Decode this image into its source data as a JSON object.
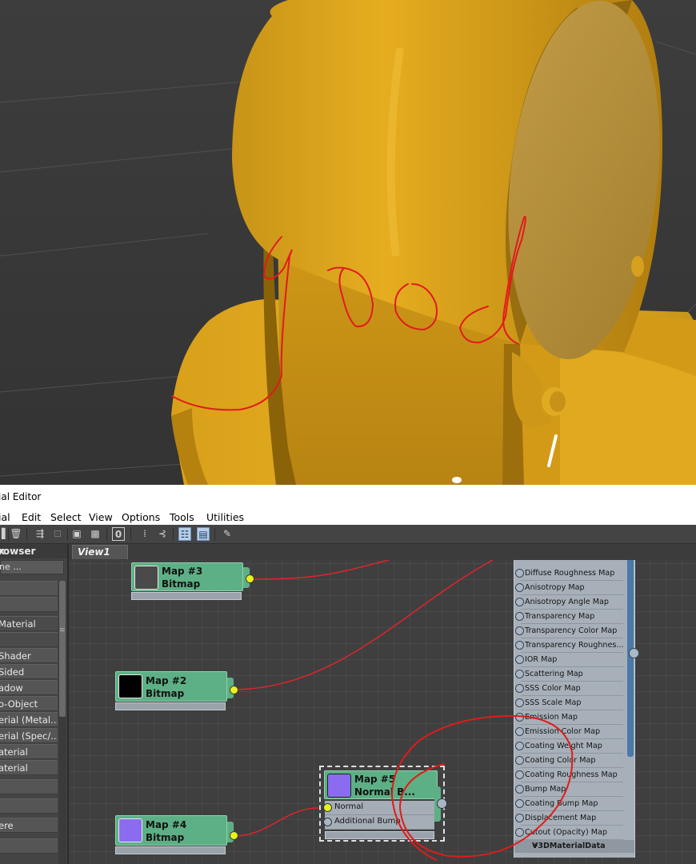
{
  "window": {
    "title": "ial Editor"
  },
  "menu": {
    "items": [
      "ial",
      "Edit",
      "Select",
      "View",
      "Options",
      "Tools",
      "Utilities"
    ]
  },
  "toolbar": {
    "zero_label": "0"
  },
  "browser": {
    "title": "rowser",
    "close_label": "x",
    "search_placeholder": "ne ...",
    "items": [
      "",
      "",
      "Material",
      "",
      "Shader",
      "Sided",
      "adow",
      "o-Object",
      "erial (Metal...",
      "erial (Spec/...",
      "aterial",
      "aterial",
      "",
      "",
      "ere",
      ""
    ]
  },
  "view_tab": {
    "label": "View1"
  },
  "nodes": {
    "map3": {
      "name": "Map #3",
      "type": "Bitmap",
      "swatch_color": "#4a4a4a"
    },
    "map2": {
      "name": "Map #2",
      "type": "Bitmap",
      "swatch_color": "#000000"
    },
    "map4": {
      "name": "Map #4",
      "type": "Bitmap",
      "swatch_color": "#8b6cf0"
    },
    "map5": {
      "name": "Map #5",
      "type": "Normal B...",
      "swatch_color": "#8b6cf0",
      "slots": [
        "Normal",
        "Additional Bump"
      ]
    }
  },
  "v3d_material": {
    "footer": "V3DMaterialData",
    "slots": [
      "Diffuse Roughness Map",
      "Anisotropy Map",
      "Anisotropy Angle Map",
      "Transparency Map",
      "Transparency Color Map",
      "Transparency Roughnes...",
      "IOR Map",
      "Scattering Map",
      "SSS Color Map",
      "SSS Scale Map",
      "Emission Map",
      "Emission Color Map",
      "Coating Weight Map",
      "Coating Color Map",
      "Coating Roughness Map",
      "Bump Map",
      "Coating Bump Map",
      "Displacement Map",
      "Cutout (Opacity) Map"
    ]
  },
  "colors": {
    "node_green": "#5db085",
    "port_yellow": "#e8f21c",
    "wire_red": "#e0242c",
    "material_yellow": "#e5ac1f",
    "annotation_red": "#e11b1b"
  }
}
